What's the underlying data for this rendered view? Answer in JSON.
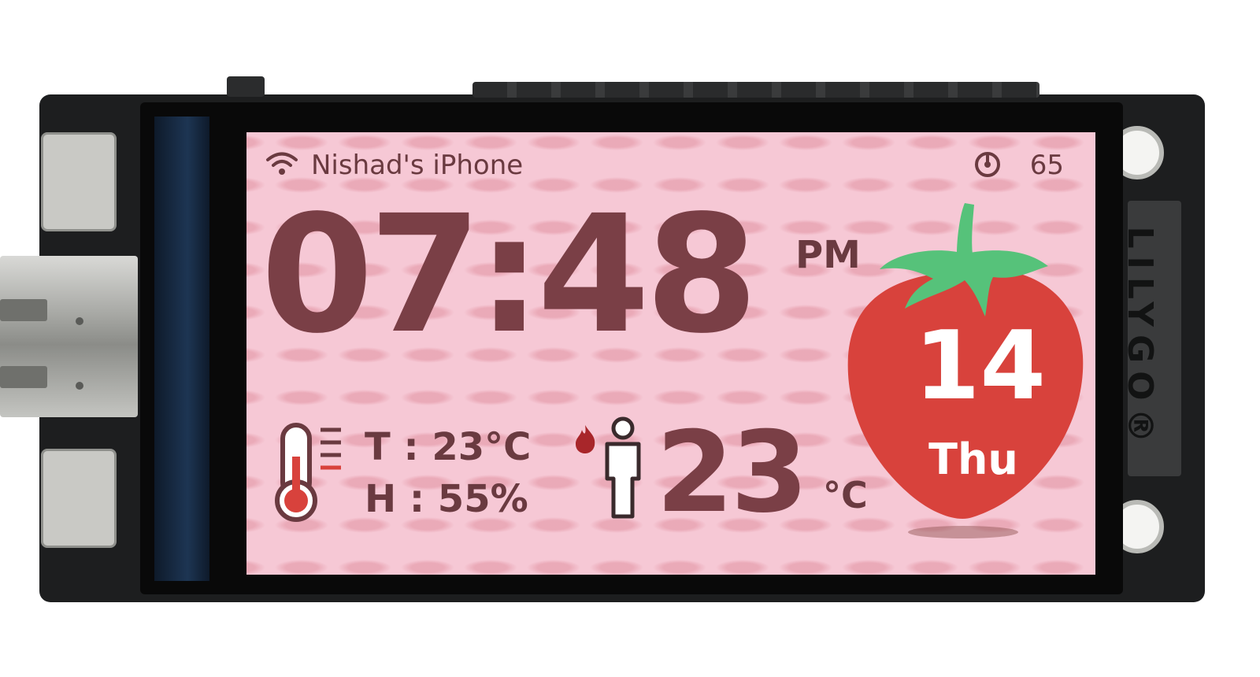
{
  "status": {
    "network_name": "Nishad's iPhone",
    "signal_value": "65"
  },
  "clock": {
    "time": "07:48",
    "ampm": "PM"
  },
  "sensor": {
    "temperature": "T : 23°C",
    "humidity": "H : 55%"
  },
  "feels_like": {
    "value": "23",
    "unit": "°C"
  },
  "date": {
    "day": "14",
    "weekday": "Thu"
  },
  "device": {
    "brand": "LILYGO®"
  },
  "colors": {
    "screen_bg": "#f6c8d5",
    "text": "#7a3f46",
    "berry_red": "#d8423c",
    "leaf_green": "#56c27a"
  },
  "icons": [
    "wifi-icon",
    "signal-icon",
    "thermometer-icon",
    "fire-icon",
    "person-icon",
    "strawberry-icon"
  ]
}
